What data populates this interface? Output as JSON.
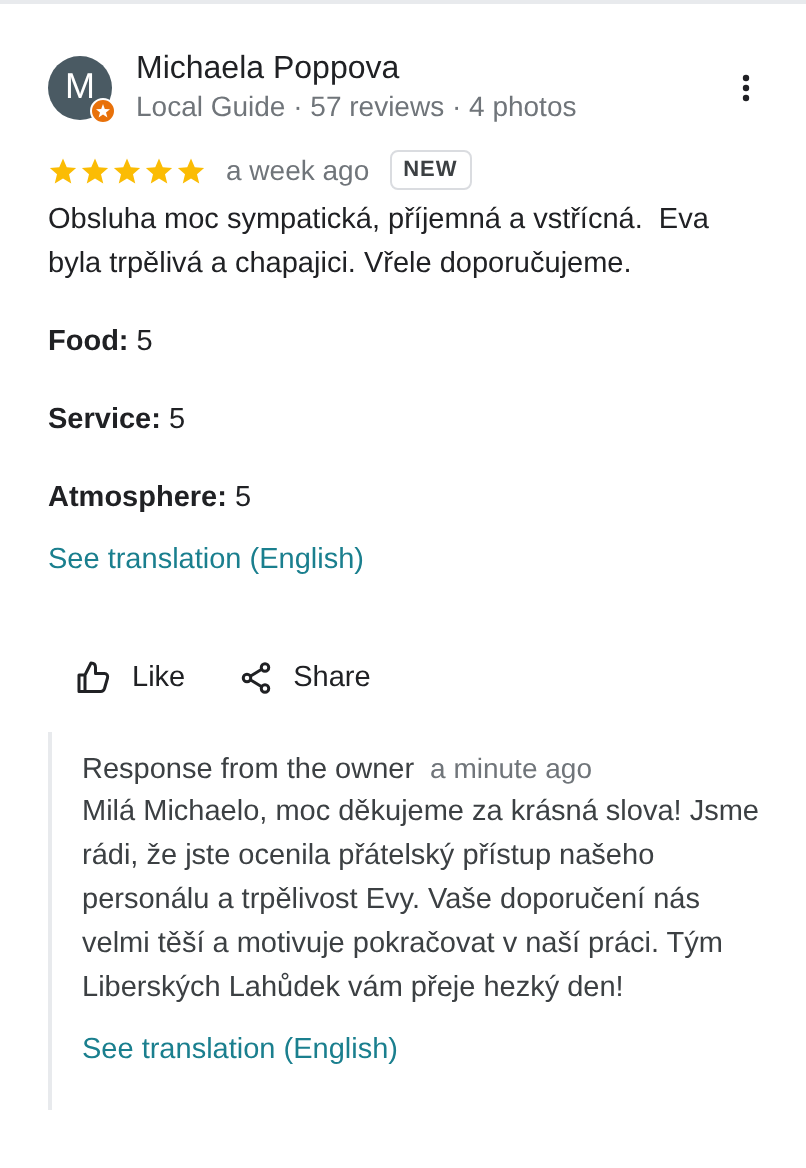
{
  "reviewer": {
    "initial": "M",
    "name": "Michaela Poppova",
    "meta": "Local Guide · 57 reviews · 4 photos",
    "local_guide": true
  },
  "review": {
    "stars": 5,
    "time": "a week ago",
    "badge": "NEW",
    "text": "Obsluha moc sympatická, příjemná a vstřícná.  Eva byla trpělivá a chapajici. Vřele doporučujeme.",
    "ratings": [
      {
        "label": "Food:",
        "value": "5"
      },
      {
        "label": "Service:",
        "value": "5"
      },
      {
        "label": "Atmosphere:",
        "value": "5"
      }
    ],
    "translation_link": "See translation (English)"
  },
  "actions": [
    {
      "kind": "like",
      "label": "Like"
    },
    {
      "kind": "share",
      "label": "Share"
    }
  ],
  "owner_response": {
    "title": "Response from the owner",
    "time": "a minute ago",
    "text": "Milá Michaelo, moc děkujeme za krásná slova! Jsme rádi, že jste ocenila přátelský přístup našeho personálu a trpělivost Evy. Vaše doporučení nás velmi těší a motivuje pokračovat v naší práci. Tým Liberských Lahůdek vám přeje hezký den!",
    "translation_link": "See translation (English)"
  }
}
